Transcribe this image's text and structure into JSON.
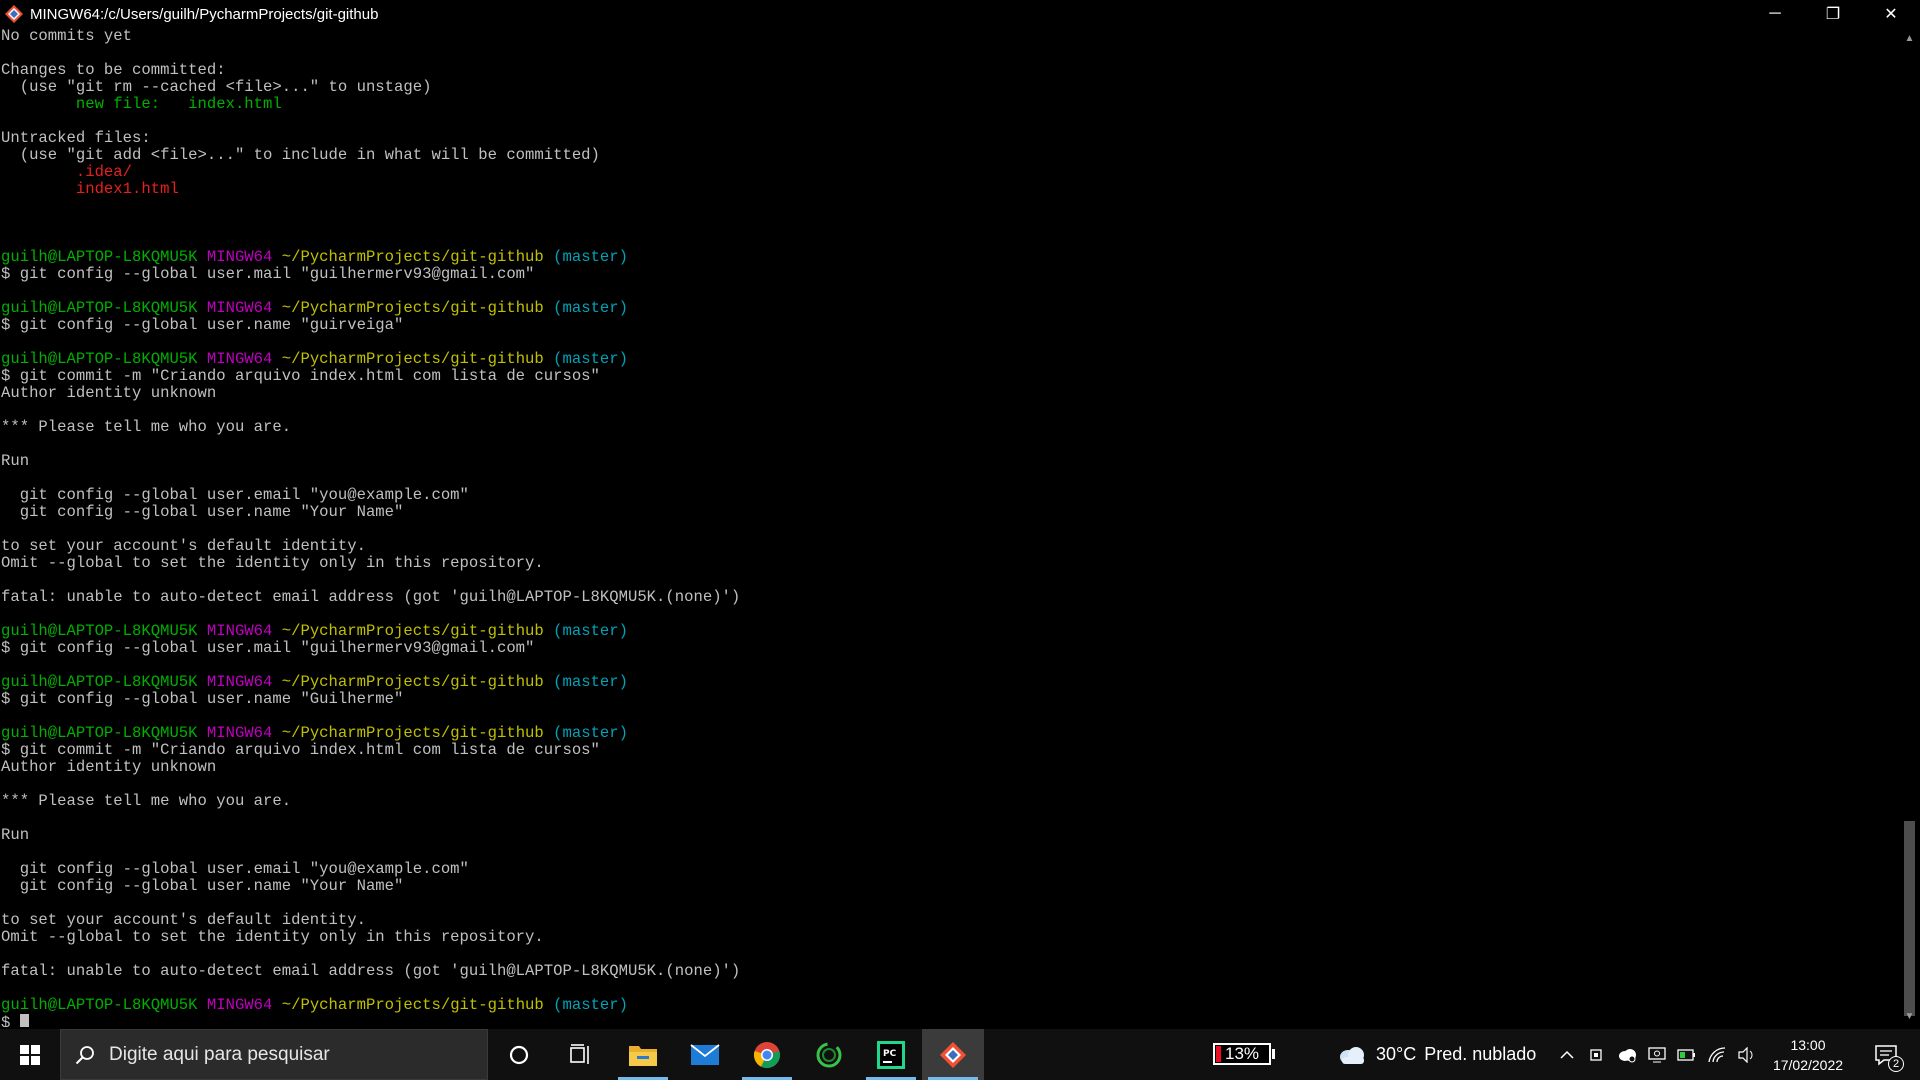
{
  "window": {
    "title": "MINGW64:/c/Users/guilh/PycharmProjects/git-github",
    "controls": {
      "minimize": "─",
      "restore": "❐",
      "close": "✕"
    }
  },
  "terminal": {
    "lines": [
      [
        {
          "t": "No commits yet",
          "c": "white"
        }
      ],
      [
        {
          "t": "",
          "c": "white"
        }
      ],
      [
        {
          "t": "Changes to be committed:",
          "c": "white"
        }
      ],
      [
        {
          "t": "  (use \"git rm --cached <file>...\" to unstage)",
          "c": "white"
        }
      ],
      [
        {
          "t": "        new file:   index.html",
          "c": "green"
        }
      ],
      [
        {
          "t": "",
          "c": "white"
        }
      ],
      [
        {
          "t": "Untracked files:",
          "c": "white"
        }
      ],
      [
        {
          "t": "  (use \"git add <file>...\" to include in what will be committed)",
          "c": "white"
        }
      ],
      [
        {
          "t": "        .idea/",
          "c": "red"
        }
      ],
      [
        {
          "t": "        index1.html",
          "c": "red"
        }
      ],
      [
        {
          "t": "",
          "c": "white"
        }
      ],
      [
        {
          "t": "",
          "c": "white"
        }
      ],
      [
        {
          "t": "",
          "c": "white"
        }
      ],
      [
        {
          "t": "guilh@LAPTOP-L8KQMU5K",
          "c": "green"
        },
        {
          "t": " ",
          "c": "white"
        },
        {
          "t": "MINGW64",
          "c": "magenta"
        },
        {
          "t": " ",
          "c": "white"
        },
        {
          "t": "~/PycharmProjects/git-github",
          "c": "yellow"
        },
        {
          "t": " ",
          "c": "white"
        },
        {
          "t": "(master)",
          "c": "cyan"
        }
      ],
      [
        {
          "t": "$ git config --global user.mail \"guilhermerv93@gmail.com\"",
          "c": "white"
        }
      ],
      [
        {
          "t": "",
          "c": "white"
        }
      ],
      [
        {
          "t": "guilh@LAPTOP-L8KQMU5K",
          "c": "green"
        },
        {
          "t": " ",
          "c": "white"
        },
        {
          "t": "MINGW64",
          "c": "magenta"
        },
        {
          "t": " ",
          "c": "white"
        },
        {
          "t": "~/PycharmProjects/git-github",
          "c": "yellow"
        },
        {
          "t": " ",
          "c": "white"
        },
        {
          "t": "(master)",
          "c": "cyan"
        }
      ],
      [
        {
          "t": "$ git config --global user.name \"guirveiga\"",
          "c": "white"
        }
      ],
      [
        {
          "t": "",
          "c": "white"
        }
      ],
      [
        {
          "t": "guilh@LAPTOP-L8KQMU5K",
          "c": "green"
        },
        {
          "t": " ",
          "c": "white"
        },
        {
          "t": "MINGW64",
          "c": "magenta"
        },
        {
          "t": " ",
          "c": "white"
        },
        {
          "t": "~/PycharmProjects/git-github",
          "c": "yellow"
        },
        {
          "t": " ",
          "c": "white"
        },
        {
          "t": "(master)",
          "c": "cyan"
        }
      ],
      [
        {
          "t": "$ git commit -m \"Criando arquivo index.html com lista de cursos\"",
          "c": "white"
        }
      ],
      [
        {
          "t": "Author identity unknown",
          "c": "white"
        }
      ],
      [
        {
          "t": "",
          "c": "white"
        }
      ],
      [
        {
          "t": "*** Please tell me who you are.",
          "c": "white"
        }
      ],
      [
        {
          "t": "",
          "c": "white"
        }
      ],
      [
        {
          "t": "Run",
          "c": "white"
        }
      ],
      [
        {
          "t": "",
          "c": "white"
        }
      ],
      [
        {
          "t": "  git config --global user.email \"you@example.com\"",
          "c": "white"
        }
      ],
      [
        {
          "t": "  git config --global user.name \"Your Name\"",
          "c": "white"
        }
      ],
      [
        {
          "t": "",
          "c": "white"
        }
      ],
      [
        {
          "t": "to set your account's default identity.",
          "c": "white"
        }
      ],
      [
        {
          "t": "Omit --global to set the identity only in this repository.",
          "c": "white"
        }
      ],
      [
        {
          "t": "",
          "c": "white"
        }
      ],
      [
        {
          "t": "fatal: unable to auto-detect email address (got 'guilh@LAPTOP-L8KQMU5K.(none)')",
          "c": "white"
        }
      ],
      [
        {
          "t": "",
          "c": "white"
        }
      ],
      [
        {
          "t": "guilh@LAPTOP-L8KQMU5K",
          "c": "green"
        },
        {
          "t": " ",
          "c": "white"
        },
        {
          "t": "MINGW64",
          "c": "magenta"
        },
        {
          "t": " ",
          "c": "white"
        },
        {
          "t": "~/PycharmProjects/git-github",
          "c": "yellow"
        },
        {
          "t": " ",
          "c": "white"
        },
        {
          "t": "(master)",
          "c": "cyan"
        }
      ],
      [
        {
          "t": "$ git config --global user.mail \"guilhermerv93@gmail.com\"",
          "c": "white"
        }
      ],
      [
        {
          "t": "",
          "c": "white"
        }
      ],
      [
        {
          "t": "guilh@LAPTOP-L8KQMU5K",
          "c": "green"
        },
        {
          "t": " ",
          "c": "white"
        },
        {
          "t": "MINGW64",
          "c": "magenta"
        },
        {
          "t": " ",
          "c": "white"
        },
        {
          "t": "~/PycharmProjects/git-github",
          "c": "yellow"
        },
        {
          "t": " ",
          "c": "white"
        },
        {
          "t": "(master)",
          "c": "cyan"
        }
      ],
      [
        {
          "t": "$ git config --global user.name \"Guilherme\"",
          "c": "white"
        }
      ],
      [
        {
          "t": "",
          "c": "white"
        }
      ],
      [
        {
          "t": "guilh@LAPTOP-L8KQMU5K",
          "c": "green"
        },
        {
          "t": " ",
          "c": "white"
        },
        {
          "t": "MINGW64",
          "c": "magenta"
        },
        {
          "t": " ",
          "c": "white"
        },
        {
          "t": "~/PycharmProjects/git-github",
          "c": "yellow"
        },
        {
          "t": " ",
          "c": "white"
        },
        {
          "t": "(master)",
          "c": "cyan"
        }
      ],
      [
        {
          "t": "$ git commit -m \"Criando arquivo index.html com lista de cursos\"",
          "c": "white"
        }
      ],
      [
        {
          "t": "Author identity unknown",
          "c": "white"
        }
      ],
      [
        {
          "t": "",
          "c": "white"
        }
      ],
      [
        {
          "t": "*** Please tell me who you are.",
          "c": "white"
        }
      ],
      [
        {
          "t": "",
          "c": "white"
        }
      ],
      [
        {
          "t": "Run",
          "c": "white"
        }
      ],
      [
        {
          "t": "",
          "c": "white"
        }
      ],
      [
        {
          "t": "  git config --global user.email \"you@example.com\"",
          "c": "white"
        }
      ],
      [
        {
          "t": "  git config --global user.name \"Your Name\"",
          "c": "white"
        }
      ],
      [
        {
          "t": "",
          "c": "white"
        }
      ],
      [
        {
          "t": "to set your account's default identity.",
          "c": "white"
        }
      ],
      [
        {
          "t": "Omit --global to set the identity only in this repository.",
          "c": "white"
        }
      ],
      [
        {
          "t": "",
          "c": "white"
        }
      ],
      [
        {
          "t": "fatal: unable to auto-detect email address (got 'guilh@LAPTOP-L8KQMU5K.(none)')",
          "c": "white"
        }
      ],
      [
        {
          "t": "",
          "c": "white"
        }
      ],
      [
        {
          "t": "guilh@LAPTOP-L8KQMU5K",
          "c": "green"
        },
        {
          "t": " ",
          "c": "white"
        },
        {
          "t": "MINGW64",
          "c": "magenta"
        },
        {
          "t": " ",
          "c": "white"
        },
        {
          "t": "~/PycharmProjects/git-github",
          "c": "yellow"
        },
        {
          "t": " ",
          "c": "white"
        },
        {
          "t": "(master)",
          "c": "cyan"
        }
      ],
      [
        {
          "t": "$ ",
          "c": "white"
        }
      ]
    ]
  },
  "colors": {
    "green": "#00b000",
    "red": "#e81f1f",
    "magenta": "#c000c0",
    "yellow": "#c0c000",
    "cyan": "#00a3b8",
    "white": "#c0c0c0"
  },
  "taskbar": {
    "search_placeholder": "Digite aqui para pesquisar",
    "apps": [
      {
        "name": "cortana-icon",
        "active": false
      },
      {
        "name": "task-view-icon",
        "active": false
      },
      {
        "name": "file-explorer-icon",
        "active": false,
        "open": true
      },
      {
        "name": "mail-icon",
        "active": false
      },
      {
        "name": "chrome-icon",
        "active": false,
        "open": true
      },
      {
        "name": "loading-circle-icon",
        "active": false
      },
      {
        "name": "pycharm-icon",
        "active": false,
        "open": true
      },
      {
        "name": "git-bash-icon",
        "active": true,
        "open": true
      }
    ],
    "battery_percent": "13%",
    "weather": {
      "temp": "30°C",
      "condition": "Pred. nublado"
    },
    "clock": {
      "time": "13:00",
      "date": "17/02/2022"
    },
    "notification_count": "2"
  }
}
